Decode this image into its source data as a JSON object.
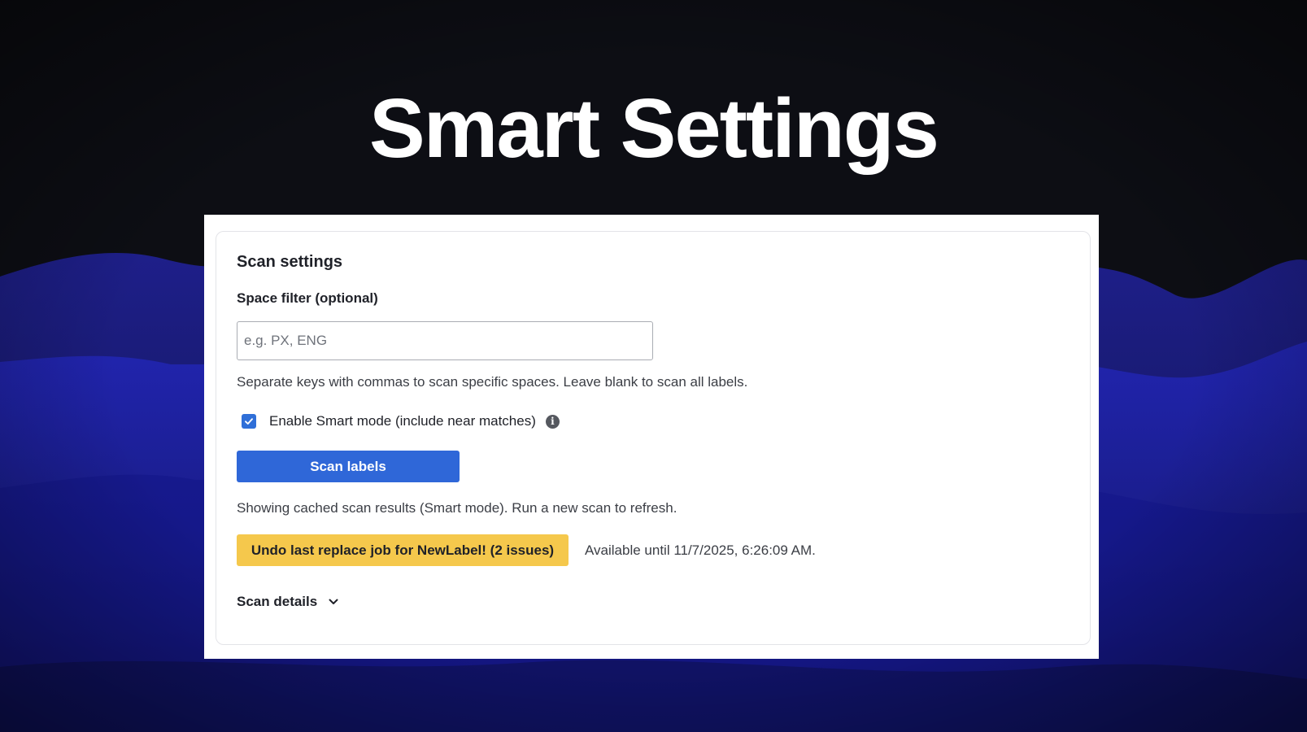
{
  "hero": {
    "title": "Smart Settings"
  },
  "scan_settings": {
    "heading": "Scan settings",
    "space_filter": {
      "label": "Space filter (optional)",
      "value": "",
      "placeholder": "e.g. PX, ENG",
      "help_text": "Separate keys with commas to scan specific spaces. Leave blank to scan all labels."
    },
    "smart_mode": {
      "label": "Enable Smart mode (include near matches)",
      "checked": true,
      "info_icon": "info-icon"
    },
    "scan_button": {
      "label": "Scan labels"
    },
    "status_text": "Showing cached scan results (Smart mode). Run a new scan to refresh.",
    "undo": {
      "label": "Undo last replace job for NewLabel! (2 issues)",
      "note": "Available until 11/7/2025, 6:26:09 AM."
    },
    "details": {
      "label": "Scan details",
      "icon": "chevron-down-icon"
    }
  },
  "colors": {
    "background": "#0d0e14",
    "wave_accent": "#1f22a8",
    "primary": "#2f67d8",
    "warning": "#f5c84c",
    "card_border": "#e3e4e8"
  }
}
